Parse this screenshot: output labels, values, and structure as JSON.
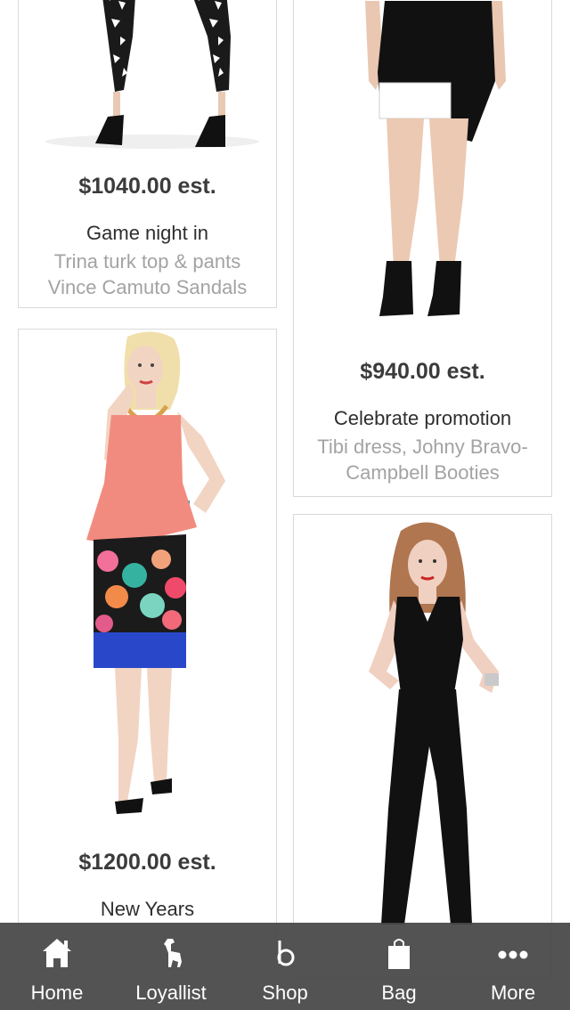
{
  "cards": [
    {
      "price": "$1040.00 est.",
      "title": "Game night in",
      "desc": [
        "Trina turk top & pants",
        "Vince Camuto Sandals"
      ]
    },
    {
      "price": "$940.00 est.",
      "title": "Celebrate promotion",
      "desc": [
        "Tibi dress, Johny Bravo-",
        "Campbell Booties"
      ]
    },
    {
      "price": "$1200.00 est.",
      "title": "New Years"
    },
    {}
  ],
  "tabbar": {
    "tabs": [
      {
        "label": "Home",
        "icon": "home-icon"
      },
      {
        "label": "Loyallist",
        "icon": "dog-icon"
      },
      {
        "label": "Shop",
        "icon": "b-logo-icon"
      },
      {
        "label": "Bag",
        "icon": "bag-icon"
      },
      {
        "label": "More",
        "icon": "more-icon"
      }
    ]
  },
  "colors": {
    "tabbar_bg": "#464646",
    "price_text": "#3b3b3b",
    "desc_text": "#a3a3a3",
    "card_border": "#d9d9d9"
  }
}
